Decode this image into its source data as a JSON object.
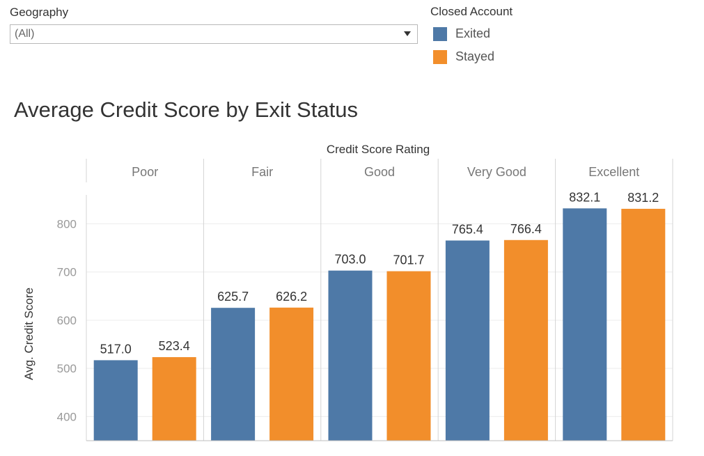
{
  "filter": {
    "label": "Geography",
    "value": "(All)"
  },
  "legend": {
    "title": "Closed Account",
    "items": [
      {
        "label": "Exited",
        "color": "#4e79a7"
      },
      {
        "label": "Stayed",
        "color": "#f28e2b"
      }
    ]
  },
  "chart_data": {
    "type": "bar",
    "title": "Average Credit Score by Exit Status",
    "column_header": "Credit Score Rating",
    "ylabel": "Avg. Credit Score",
    "categories": [
      "Poor",
      "Fair",
      "Good",
      "Very Good",
      "Excellent"
    ],
    "series": [
      {
        "name": "Exited",
        "color": "#4e79a7",
        "values": [
          517.0,
          625.7,
          703.0,
          765.4,
          832.1
        ],
        "labels": [
          "517.0",
          "625.7",
          "703.0",
          "765.4",
          "832.1"
        ]
      },
      {
        "name": "Stayed",
        "color": "#f28e2b",
        "values": [
          523.4,
          626.2,
          701.7,
          766.4,
          831.2
        ],
        "labels": [
          "523.4",
          "626.2",
          "701.7",
          "766.4",
          "831.2"
        ]
      }
    ],
    "ylim": [
      350,
      860
    ],
    "yticks": [
      400,
      500,
      600,
      700,
      800
    ],
    "grid": true,
    "legend_position": "top-right"
  }
}
